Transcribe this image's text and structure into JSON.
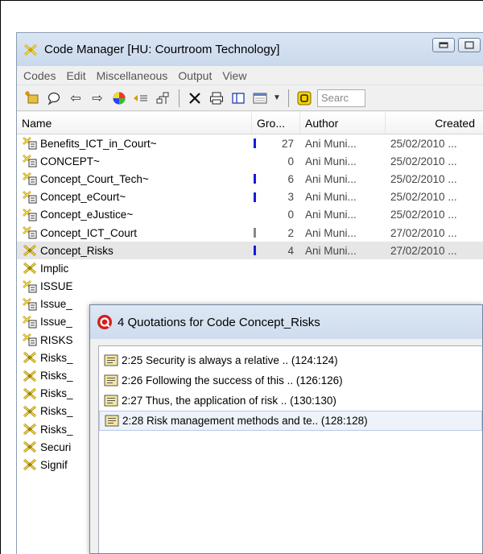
{
  "window": {
    "title": "Code Manager [HU: Courtroom Technology]",
    "minimize_glyph": "▭",
    "restore_glyph": "▭"
  },
  "menu": [
    "Codes",
    "Edit",
    "Miscellaneous",
    "Output",
    "View"
  ],
  "toolbar": {
    "search_placeholder": "Searc"
  },
  "columns": {
    "name": "Name",
    "groundedness": "Gro...",
    "author": "Author",
    "created": "Created"
  },
  "rows": [
    {
      "name": "Benefits_ICT_in_Court~",
      "grounded": "27",
      "bar": "blue",
      "author": "Ani Muni...",
      "created": "25/02/2010 ..."
    },
    {
      "name": "CONCEPT~",
      "grounded": "0",
      "bar": "",
      "author": "Ani Muni...",
      "created": "25/02/2010 ..."
    },
    {
      "name": "Concept_Court_Tech~",
      "grounded": "6",
      "bar": "blue",
      "author": "Ani Muni...",
      "created": "25/02/2010 ..."
    },
    {
      "name": "Concept_eCourt~",
      "grounded": "3",
      "bar": "blue",
      "author": "Ani Muni...",
      "created": "25/02/2010 ..."
    },
    {
      "name": "Concept_eJustice~",
      "grounded": "0",
      "bar": "",
      "author": "Ani Muni...",
      "created": "25/02/2010 ..."
    },
    {
      "name": "Concept_ICT_Court",
      "grounded": "2",
      "bar": "gray",
      "author": "Ani Muni...",
      "created": "27/02/2010 ..."
    },
    {
      "name": "Concept_Risks",
      "grounded": "4",
      "bar": "blue",
      "author": "Ani Muni...",
      "created": "27/02/2010 ...",
      "selected": true
    },
    {
      "name": "Implic",
      "grounded": "",
      "bar": "",
      "author": "",
      "created": ""
    },
    {
      "name": "ISSUE",
      "grounded": "",
      "bar": "",
      "author": "",
      "created": ""
    },
    {
      "name": "Issue_",
      "grounded": "",
      "bar": "",
      "author": "",
      "created": ""
    },
    {
      "name": "Issue_",
      "grounded": "",
      "bar": "",
      "author": "",
      "created": ""
    },
    {
      "name": "RISKS",
      "grounded": "",
      "bar": "",
      "author": "",
      "created": ""
    },
    {
      "name": "Risks_",
      "grounded": "",
      "bar": "",
      "author": "",
      "created": ""
    },
    {
      "name": "Risks_",
      "grounded": "",
      "bar": "",
      "author": "",
      "created": ""
    },
    {
      "name": "Risks_",
      "grounded": "",
      "bar": "",
      "author": "",
      "created": ""
    },
    {
      "name": "Risks_",
      "grounded": "",
      "bar": "",
      "author": "",
      "created": ""
    },
    {
      "name": "Risks_",
      "grounded": "",
      "bar": "",
      "author": "",
      "created": ""
    },
    {
      "name": "Securi",
      "grounded": "",
      "bar": "",
      "author": "",
      "created": ""
    },
    {
      "name": "Signif",
      "grounded": "",
      "bar": "",
      "author": "",
      "created": ""
    }
  ],
  "popup": {
    "title": "4 Quotations for Code Concept_Risks",
    "quotations": [
      {
        "text": "2:25 Security is always a relative .. (124:124)"
      },
      {
        "text": "2:26 Following the success of this .. (126:126)"
      },
      {
        "text": "2:27 Thus, the application of risk .. (130:130)"
      },
      {
        "text": "2:28 Risk management methods and te.. (128:128)",
        "selected": true
      }
    ]
  },
  "colors": {
    "bar_blue": "#1a1adb",
    "bar_gray": "#888888",
    "accent_red": "#d42020"
  }
}
